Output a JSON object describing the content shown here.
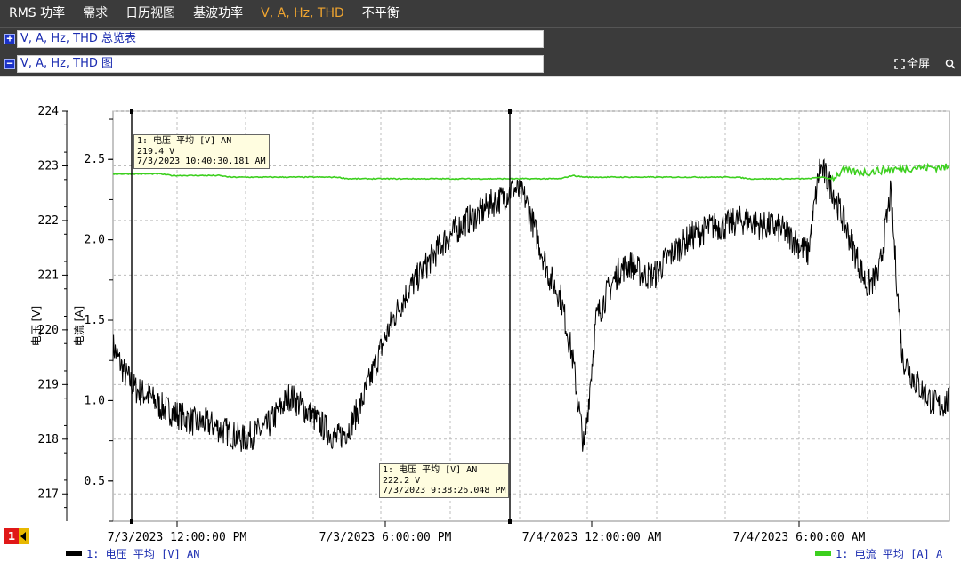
{
  "menu": [
    "RMS 功率",
    "需求",
    "日历视图",
    "基波功率",
    "V, A, Hz, THD",
    "不平衡"
  ],
  "panels": {
    "overview": {
      "toggle": "+",
      "label": "V, A, Hz, THD 总览表"
    },
    "chart": {
      "toggle": "−",
      "label": "V, A, Hz, THD 图"
    }
  },
  "toolbar": {
    "fullscreen_label": "全屏"
  },
  "marker_badge": "1",
  "chart_data": {
    "type": "line",
    "x_tick_labels": [
      "7/3/2023 12:00:00 PM",
      "7/3/2023 6:00:00 PM",
      "7/4/2023 12:00:00 AM",
      "7/4/2023 6:00:00 AM"
    ],
    "y_left": {
      "label": "电压 [V]",
      "ticks": [
        "224",
        "223",
        "222",
        "221",
        "220",
        "219",
        "218",
        "217"
      ],
      "range": [
        216.5,
        224
      ]
    },
    "y_right": {
      "label": "电流 [A]",
      "ticks": [
        "2.5",
        "2.0",
        "1.5",
        "1.0",
        "0.5"
      ],
      "range": [
        0.25,
        2.8
      ]
    },
    "grid": true,
    "series": [
      {
        "name": "1: 电压 平均 [V] AN",
        "color": "#000000",
        "axis": "left",
        "values": [
          219.7,
          219.2,
          218.9,
          218.8,
          218.6,
          218.5,
          218.4,
          218.3,
          218.3,
          218.2,
          218.1,
          218.0,
          218.1,
          218.2,
          218.5,
          218.8,
          218.6,
          218.4,
          218.2,
          218.0,
          218.2,
          218.6,
          219.2,
          219.8,
          220.3,
          220.7,
          221.0,
          221.3,
          221.6,
          221.8,
          222.0,
          222.1,
          222.3,
          222.4,
          222.6,
          222.4,
          221.7,
          221.0,
          220.6,
          219.5,
          217.8,
          220.2,
          220.7,
          221.1,
          221.2,
          221.0,
          221.0,
          221.3,
          221.5,
          221.7,
          221.8,
          221.9,
          221.9,
          222.0,
          222.0,
          221.9,
          221.9,
          221.8,
          221.6,
          221.4,
          223.0,
          222.6,
          222.0,
          221.4,
          220.8,
          221.0,
          222.5,
          219.5,
          219.1,
          218.8,
          218.6,
          218.7
        ]
      },
      {
        "name": "1: 电流 平均 [A] A",
        "color": "#3ccf1e",
        "axis": "right",
        "values": [
          2.41,
          2.41,
          2.41,
          2.41,
          2.41,
          2.4,
          2.4,
          2.4,
          2.4,
          2.4,
          2.39,
          2.39,
          2.39,
          2.39,
          2.39,
          2.39,
          2.39,
          2.39,
          2.39,
          2.39,
          2.38,
          2.38,
          2.38,
          2.38,
          2.38,
          2.38,
          2.38,
          2.38,
          2.38,
          2.38,
          2.38,
          2.38,
          2.38,
          2.38,
          2.38,
          2.38,
          2.38,
          2.38,
          2.38,
          2.4,
          2.39,
          2.39,
          2.39,
          2.39,
          2.39,
          2.39,
          2.39,
          2.39,
          2.39,
          2.39,
          2.39,
          2.39,
          2.39,
          2.39,
          2.38,
          2.38,
          2.38,
          2.38,
          2.38,
          2.38,
          2.39,
          2.38,
          2.43,
          2.42,
          2.42,
          2.43,
          2.44,
          2.44,
          2.45,
          2.45,
          2.45,
          2.45
        ]
      }
    ],
    "cursors": [
      {
        "label": "1: 电压 平均 [V] AN",
        "value": "219.4 V",
        "time": "7/3/2023 10:40:30.181 AM"
      },
      {
        "label": "1: 电压 平均 [V] AN",
        "value": "222.2 V",
        "time": "7/3/2023 9:38:26.048 PM"
      }
    ],
    "legend": {
      "left": "1: 电压 平均 [V] AN",
      "right": "1: 电流 平均 [A] A"
    }
  }
}
